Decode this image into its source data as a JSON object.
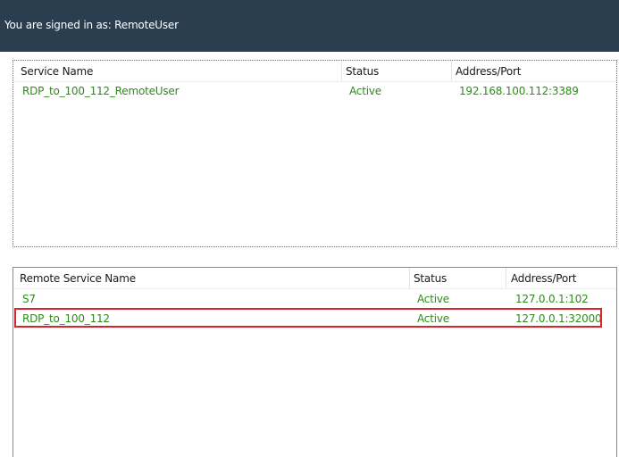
{
  "header": {
    "signed_in_text": "You are signed in as: RemoteUser"
  },
  "local_services": {
    "columns": {
      "name": "Service Name",
      "status": "Status",
      "address": "Address/Port"
    },
    "rows": [
      {
        "name": "RDP_to_100_112_RemoteUser",
        "status": "Active",
        "address": "192.168.100.112:3389"
      }
    ]
  },
  "remote_services": {
    "columns": {
      "name": "Remote Service Name",
      "status": "Status",
      "address": "Address/Port"
    },
    "rows": [
      {
        "name": "S7",
        "status": "Active",
        "address": "127.0.0.1:102"
      },
      {
        "name": "RDP_to_100_112",
        "status": "Active",
        "address": "127.0.0.1:32000"
      }
    ]
  },
  "colors": {
    "header_bg": "#2b3e50",
    "active_text": "#2e8b1e",
    "highlight_border": "#d9232d"
  }
}
